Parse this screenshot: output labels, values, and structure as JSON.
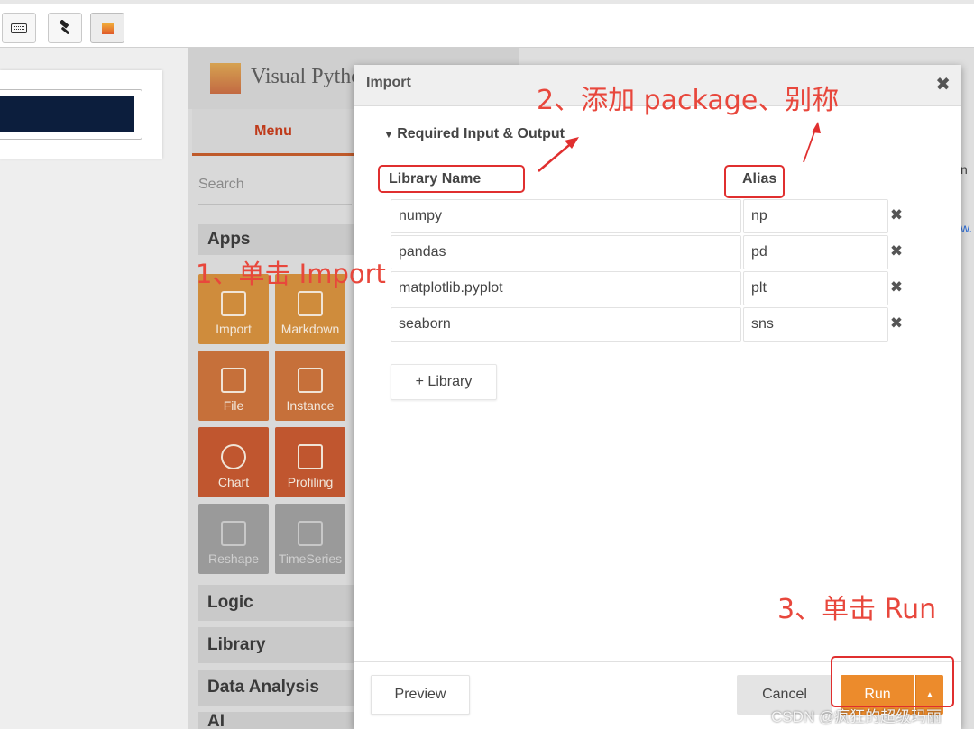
{
  "toolbar": {
    "buttons": [
      {
        "icon": "keyboard-icon"
      },
      {
        "icon": "hammer-icon"
      },
      {
        "icon": "visualpython-icon"
      }
    ]
  },
  "vp_panel": {
    "title": "Visual Python",
    "menu_tab": "Menu",
    "search_placeholder": "Search",
    "sections": {
      "apps": "Apps",
      "logic": "Logic",
      "library": "Library",
      "data_analysis": "Data Analysis",
      "ai": "AI"
    },
    "apps": [
      {
        "label": "Import",
        "icon": "import-icon"
      },
      {
        "label": "Markdown",
        "icon": "markdown-icon"
      },
      {
        "label": "File",
        "icon": "file-icon"
      },
      {
        "label": "Instance",
        "icon": "instance-icon"
      },
      {
        "label": "Chart",
        "icon": "chart-icon"
      },
      {
        "label": "Profiling",
        "icon": "profiling-icon"
      },
      {
        "label": "Reshape",
        "icon": "reshape-icon"
      },
      {
        "label": "TimeSeries",
        "icon": "timeseries-icon"
      }
    ]
  },
  "right_area": {
    "snippets": [
      "n",
      "w."
    ]
  },
  "dialog": {
    "title": "Import",
    "section": "Required Input & Output",
    "columns": {
      "library": "Library Name",
      "alias": "Alias"
    },
    "rows": [
      {
        "library": "numpy",
        "alias": "np"
      },
      {
        "library": "pandas",
        "alias": "pd"
      },
      {
        "library": "matplotlib.pyplot",
        "alias": "plt"
      },
      {
        "library": "seaborn",
        "alias": "sns"
      }
    ],
    "add_library": "+ Library",
    "buttons": {
      "preview": "Preview",
      "cancel": "Cancel",
      "run": "Run"
    }
  },
  "annotations": {
    "step1": "1、单击 Import",
    "step2": "2、添加 package、别称",
    "step3": "3、单击 Run",
    "color": "#e8473c"
  },
  "watermark": "CSDN @疯狂的超级玛丽"
}
